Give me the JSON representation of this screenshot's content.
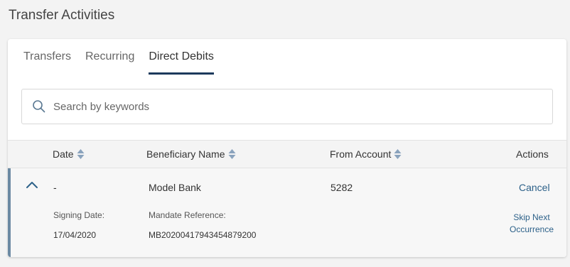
{
  "page": {
    "title": "Transfer Activities"
  },
  "tabs": [
    {
      "label": "Transfers",
      "active": false
    },
    {
      "label": "Recurring",
      "active": false
    },
    {
      "label": "Direct Debits",
      "active": true
    }
  ],
  "search": {
    "placeholder": "Search by keywords",
    "value": "",
    "icon": "search-icon"
  },
  "table": {
    "columns": {
      "date": "Date",
      "beneficiary": "Beneficiary Name",
      "from_account": "From Account",
      "actions": "Actions"
    },
    "rows": [
      {
        "date": "-",
        "beneficiary": "Model Bank",
        "from_account": "5282",
        "cancel_label": "Cancel",
        "expanded": true,
        "details": {
          "signing_date_label": "Signing Date:",
          "signing_date": "17/04/2020",
          "mandate_reference_label": "Mandate Reference:",
          "mandate_reference": "MB20200417943454879200",
          "skip_label_line1": "Skip Next",
          "skip_label_line2": "Occurrence"
        }
      }
    ]
  },
  "colors": {
    "accent": "#1d3a5c",
    "link": "#2d6189",
    "row_marker": "#6c8aa3",
    "sort_icon": "#8aa3bd"
  }
}
